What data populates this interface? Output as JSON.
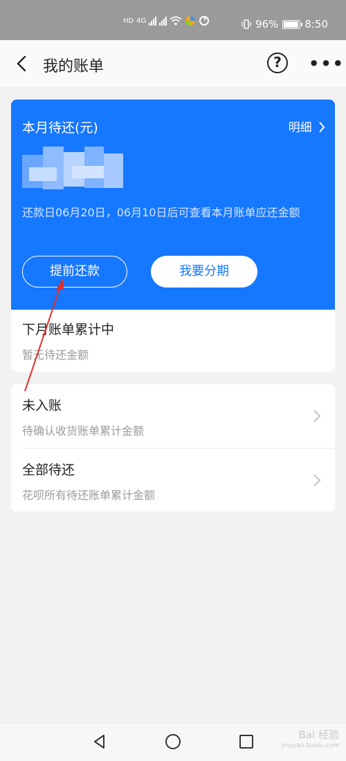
{
  "status_bar": {
    "net_left": "HD",
    "net_right": "4G",
    "battery": "96%",
    "time": "8:50"
  },
  "header": {
    "title": "我的账单",
    "help_symbol": "?"
  },
  "bill_card": {
    "title": "本月待还(元)",
    "detail_link": "明细",
    "note": "还款日06月20日，06月10日后可查看本月账单应还金额",
    "prepay_button": "提前还款",
    "installment_button": "我要分期",
    "accent": "#1677ff"
  },
  "next_month": {
    "title": "下月账单累计中",
    "subtitle": "暂无待还金额"
  },
  "list": [
    {
      "title": "未入账",
      "subtitle": "待确认收货账单累计金额"
    },
    {
      "title": "全部待还",
      "subtitle": "花呗所有待还账单累计金额"
    }
  ],
  "watermark": {
    "brand": "Bai 经验",
    "url": "jingyan.baidu.com"
  }
}
